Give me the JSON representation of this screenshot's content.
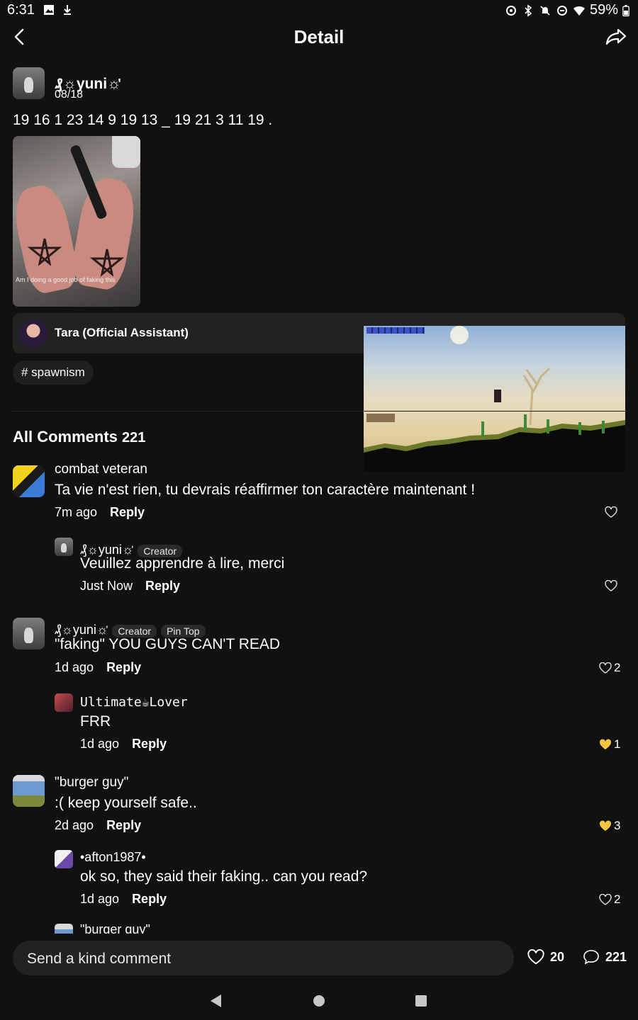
{
  "status_bar": {
    "time": "6:31",
    "battery": "59%"
  },
  "header": {
    "title": "Detail"
  },
  "post": {
    "author": "₰☼yuni☼ᡃ",
    "date": "08/18",
    "text": "19 16 1 23 14 9 19 13 _ 19 21 3 11 19 .",
    "image_caption": "Am I doing a good job of faking this",
    "assistant_name": "Tara (Official Assistant)",
    "tag": "# spawnism"
  },
  "comments_header": {
    "title": "All Comments",
    "count": "221"
  },
  "comments": [
    {
      "author": "combat veteran",
      "text": "Ta vie n'est rien, tu devrais réaffirmer ton caractère maintenant !",
      "time": "7m ago",
      "reply": "Reply",
      "likes": ""
    },
    {
      "author": "₰☼yuni☼ᡃ",
      "badge1": "Creator",
      "text": "Veuillez apprendre à lire, merci",
      "time": "Just Now",
      "reply": "Reply",
      "likes": ""
    },
    {
      "author": "₰☼yuni☼ᡃ",
      "badge1": "Creator",
      "badge2": "Pin Top",
      "text": "\"faking\" YOU GUYS CAN'T READ",
      "time": "1d ago",
      "reply": "Reply",
      "likes": "2"
    },
    {
      "author": "Ultimate☕Lover",
      "text": "FRR",
      "time": "1d ago",
      "reply": "Reply",
      "likes": "1"
    },
    {
      "author": "\"burger guy\"",
      "text": ":( keep yourself safe..",
      "time": "2d ago",
      "reply": "Reply",
      "likes": "3"
    },
    {
      "author": "•afton1987•",
      "text": "ok so, they said their faking.. can you read?",
      "time": "1d ago",
      "reply": "Reply",
      "likes": "2"
    },
    {
      "author": "\"burger guy\""
    }
  ],
  "bottom_bar": {
    "placeholder": "Send a kind comment",
    "likes": "20",
    "comments": "221"
  },
  "colors": {
    "background": "#111111",
    "card": "#222222",
    "like_active": "#f5c542"
  }
}
